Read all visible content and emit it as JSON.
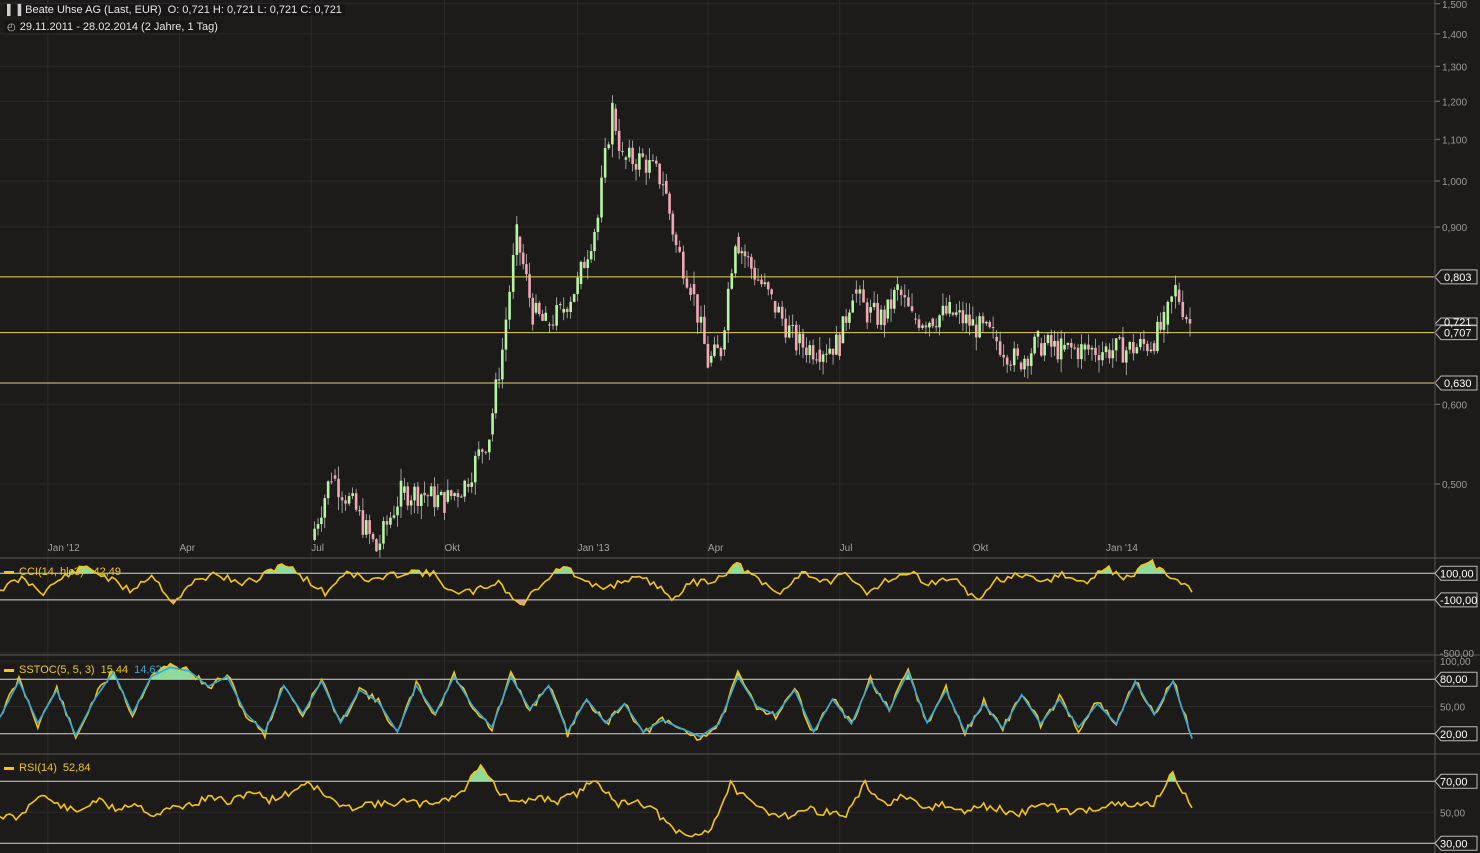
{
  "header": {
    "instrument": "Beate Uhse AG (Last, EUR)",
    "ohlc": "O: 0,721   H: 0,721   L: 0,721   C: 0,721",
    "range": "29.11.2011 - 28.02.2014 (2 Jahre, 1 Tag)",
    "chart_icon": "candlestick-icon",
    "clock_icon": "clock-icon"
  },
  "colors": {
    "background": "#1c1b1a",
    "up_candle": "#b6f5a2",
    "down_candle": "#f2a7b3",
    "indicator_line": "#f2c512",
    "signal_line": "#35a7d8",
    "level_line": "#e8d26a",
    "cci_fill_up": "#9cf0a8",
    "cci_fill_down": "#f5a9b6"
  },
  "chart_data": [
    {
      "type": "candlestick",
      "title": "Beate Uhse AG (Last, EUR)",
      "y_scale": "log",
      "y_ticks": [
        "0,500",
        "0,600",
        "0,900",
        "1,000",
        "1,100",
        "1,200",
        "1,300",
        "1,400",
        "1,500"
      ],
      "x_ticks": [
        "Jan '12",
        "Apr",
        "Jul",
        "Okt",
        "Jan '13",
        "Apr",
        "Jul",
        "Okt",
        "Jan '14"
      ],
      "horizontal_levels": [
        {
          "value": 0.803,
          "label": "0,803"
        },
        {
          "value": 0.707,
          "label": "0,707"
        },
        {
          "value": 0.63,
          "label": "0,630"
        }
      ],
      "last_label": "0,721",
      "close_series": [
        {
          "date": "2012-07-01",
          "close": 0.44
        },
        {
          "date": "2012-07-15",
          "close": 0.51
        },
        {
          "date": "2012-08-01",
          "close": 0.47
        },
        {
          "date": "2012-08-15",
          "close": 0.43
        },
        {
          "date": "2012-09-01",
          "close": 0.49
        },
        {
          "date": "2012-09-15",
          "close": 0.49
        },
        {
          "date": "2012-10-01",
          "close": 0.48
        },
        {
          "date": "2012-10-15",
          "close": 0.5
        },
        {
          "date": "2012-11-01",
          "close": 0.56
        },
        {
          "date": "2012-11-10",
          "close": 0.68
        },
        {
          "date": "2012-11-20",
          "close": 0.88
        },
        {
          "date": "2012-12-01",
          "close": 0.74
        },
        {
          "date": "2012-12-10",
          "close": 0.72
        },
        {
          "date": "2012-12-20",
          "close": 0.74
        },
        {
          "date": "2013-01-01",
          "close": 0.79
        },
        {
          "date": "2013-01-15",
          "close": 0.92
        },
        {
          "date": "2013-01-25",
          "close": 1.18
        },
        {
          "date": "2013-02-01",
          "close": 1.05
        },
        {
          "date": "2013-02-15",
          "close": 1.05
        },
        {
          "date": "2013-03-01",
          "close": 1.0
        },
        {
          "date": "2013-03-10",
          "close": 0.86
        },
        {
          "date": "2013-03-20",
          "close": 0.79
        },
        {
          "date": "2013-04-01",
          "close": 0.66
        },
        {
          "date": "2013-04-10",
          "close": 0.68
        },
        {
          "date": "2013-04-20",
          "close": 0.88
        },
        {
          "date": "2013-05-01",
          "close": 0.82
        },
        {
          "date": "2013-05-15",
          "close": 0.76
        },
        {
          "date": "2013-06-01",
          "close": 0.69
        },
        {
          "date": "2013-06-15",
          "close": 0.68
        },
        {
          "date": "2013-07-01",
          "close": 0.69
        },
        {
          "date": "2013-07-10",
          "close": 0.78
        },
        {
          "date": "2013-07-20",
          "close": 0.74
        },
        {
          "date": "2013-08-01",
          "close": 0.73
        },
        {
          "date": "2013-08-10",
          "close": 0.78
        },
        {
          "date": "2013-08-20",
          "close": 0.73
        },
        {
          "date": "2013-09-01",
          "close": 0.73
        },
        {
          "date": "2013-09-15",
          "close": 0.74
        },
        {
          "date": "2013-10-01",
          "close": 0.72
        },
        {
          "date": "2013-10-15",
          "close": 0.7
        },
        {
          "date": "2013-11-01",
          "close": 0.66
        },
        {
          "date": "2013-11-15",
          "close": 0.69
        },
        {
          "date": "2013-12-01",
          "close": 0.68
        },
        {
          "date": "2013-12-15",
          "close": 0.68
        },
        {
          "date": "2014-01-01",
          "close": 0.68
        },
        {
          "date": "2014-01-15",
          "close": 0.68
        },
        {
          "date": "2014-02-01",
          "close": 0.69
        },
        {
          "date": "2014-02-10",
          "close": 0.72
        },
        {
          "date": "2014-02-18",
          "close": 0.78
        },
        {
          "date": "2014-02-28",
          "close": 0.721
        }
      ]
    },
    {
      "type": "line",
      "title": "CCI(14, hlc3)",
      "value_label": "-42,49",
      "y_ticks": [
        "100,00",
        "-100,00",
        "-500,00"
      ],
      "levels": [
        100,
        -100
      ],
      "series": [
        {
          "name": "CCI(14, hlc3)",
          "values": [
            -20,
            60,
            -40,
            80,
            150,
            60,
            -30,
            90,
            -120,
            40,
            100,
            20,
            60,
            180,
            70,
            -50,
            120,
            40,
            80,
            120,
            90,
            -60,
            -30,
            40,
            -150,
            30,
            160,
            20,
            -10,
            60,
            40,
            -80,
            30,
            50,
            170,
            40,
            -60,
            120,
            30,
            80,
            -40,
            60,
            100,
            20,
            70,
            -110,
            50,
            80,
            30,
            90,
            20,
            140,
            60,
            190,
            80,
            -42.49
          ]
        }
      ]
    },
    {
      "type": "line",
      "title": "SSTOC(5, 5, 3)",
      "value_label": "15,44",
      "signal_label": "14,62",
      "y_ticks": [
        "100,00",
        "80,00",
        "50,00",
        "20,00"
      ],
      "levels": [
        80,
        20
      ],
      "series": [
        {
          "name": "SSTOC(5, 5, 3)",
          "values": [
            40,
            80,
            30,
            70,
            15,
            60,
            90,
            40,
            85,
            95,
            90,
            70,
            85,
            40,
            20,
            75,
            40,
            80,
            30,
            70,
            55,
            20,
            75,
            40,
            85,
            50,
            25,
            85,
            45,
            75,
            20,
            60,
            30,
            55,
            20,
            35,
            25,
            15,
            30,
            85,
            50,
            40,
            70,
            20,
            60,
            30,
            80,
            45,
            90,
            30,
            70,
            20,
            55,
            25,
            65,
            30,
            60,
            25,
            55,
            30,
            80,
            40,
            80,
            15.44
          ]
        },
        {
          "name": "signal",
          "values": [
            38,
            78,
            32,
            68,
            18,
            58,
            88,
            42,
            83,
            93,
            89,
            72,
            83,
            42,
            22,
            73,
            42,
            78,
            32,
            68,
            55,
            22,
            73,
            42,
            83,
            50,
            27,
            83,
            47,
            73,
            22,
            58,
            32,
            53,
            22,
            35,
            26,
            17,
            31,
            83,
            50,
            41,
            68,
            22,
            58,
            31,
            78,
            46,
            88,
            32,
            68,
            22,
            53,
            26,
            63,
            31,
            58,
            27,
            53,
            31,
            78,
            41,
            78,
            14.62
          ]
        }
      ]
    },
    {
      "type": "line",
      "title": "RSI(14)",
      "value_label": "52,84",
      "y_ticks": [
        "70,00",
        "50,00",
        "30,00"
      ],
      "levels": [
        70,
        30
      ],
      "series": [
        {
          "name": "RSI(14)",
          "values": [
            48,
            46,
            62,
            55,
            50,
            58,
            52,
            56,
            48,
            53,
            55,
            60,
            56,
            64,
            58,
            62,
            70,
            60,
            52,
            56,
            55,
            57,
            55,
            58,
            62,
            82,
            62,
            55,
            60,
            57,
            62,
            72,
            55,
            58,
            52,
            38,
            34,
            40,
            68,
            56,
            50,
            48,
            52,
            50,
            48,
            68,
            55,
            60,
            52,
            55,
            50,
            54,
            52,
            48,
            56,
            52,
            50,
            53,
            55,
            54,
            56,
            75,
            52.84
          ]
        }
      ]
    }
  ]
}
